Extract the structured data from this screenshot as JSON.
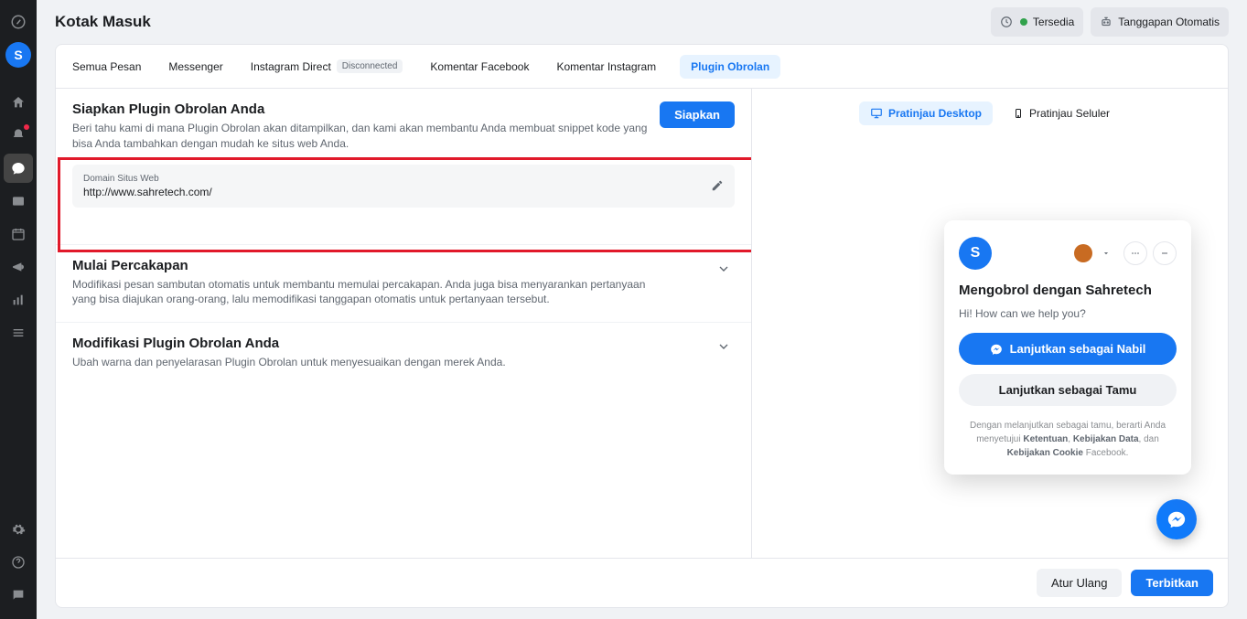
{
  "header": {
    "title": "Kotak Masuk",
    "availability_label": "Tersedia",
    "auto_response_label": "Tanggapan Otomatis"
  },
  "tabs": [
    {
      "label": "Semua Pesan"
    },
    {
      "label": "Messenger"
    },
    {
      "label": "Instagram Direct",
      "badge": "Disconnected"
    },
    {
      "label": "Komentar Facebook"
    },
    {
      "label": "Komentar Instagram"
    },
    {
      "label": "Plugin Obrolan",
      "active": true
    }
  ],
  "section_setup": {
    "title": "Siapkan Plugin Obrolan Anda",
    "desc": "Beri tahu kami di mana Plugin Obrolan akan ditampilkan, dan kami akan membantu Anda membuat snippet kode yang bisa Anda tambahkan dengan mudah ke situs web Anda.",
    "cta": "Siapkan",
    "domain_label": "Domain Situs Web",
    "domain_value": "http://www.sahretech.com/"
  },
  "section_start": {
    "title": "Mulai Percakapan",
    "desc": "Modifikasi pesan sambutan otomatis untuk membantu memulai percakapan. Anda juga bisa menyarankan pertanyaan yang bisa diajukan orang-orang, lalu memodifikasi tanggapan otomatis untuk pertanyaan tersebut."
  },
  "section_modify": {
    "title": "Modifikasi Plugin Obrolan Anda",
    "desc": "Ubah warna dan penyelarasan Plugin Obrolan untuk menyesuaikan dengan merek Anda."
  },
  "preview": {
    "desktop_label": "Pratinjau Desktop",
    "mobile_label": "Pratinjau Seluler"
  },
  "chat": {
    "title": "Mengobrol dengan Sahretech",
    "greeting": "Hi! How can we help you?",
    "continue_as": "Lanjutkan sebagai Nabil",
    "continue_guest": "Lanjutkan sebagai Tamu",
    "disclaimer_pre": "Dengan melanjutkan sebagai tamu, berarti Anda menyetujui ",
    "terms": "Ketentuan",
    "data_policy": "Kebijakan Data",
    "cookie_policy": "Kebijakan Cookie",
    "and": ", dan ",
    "fb": " Facebook."
  },
  "footer": {
    "reset": "Atur Ulang",
    "publish": "Terbitkan"
  },
  "avatar_letter": "S"
}
